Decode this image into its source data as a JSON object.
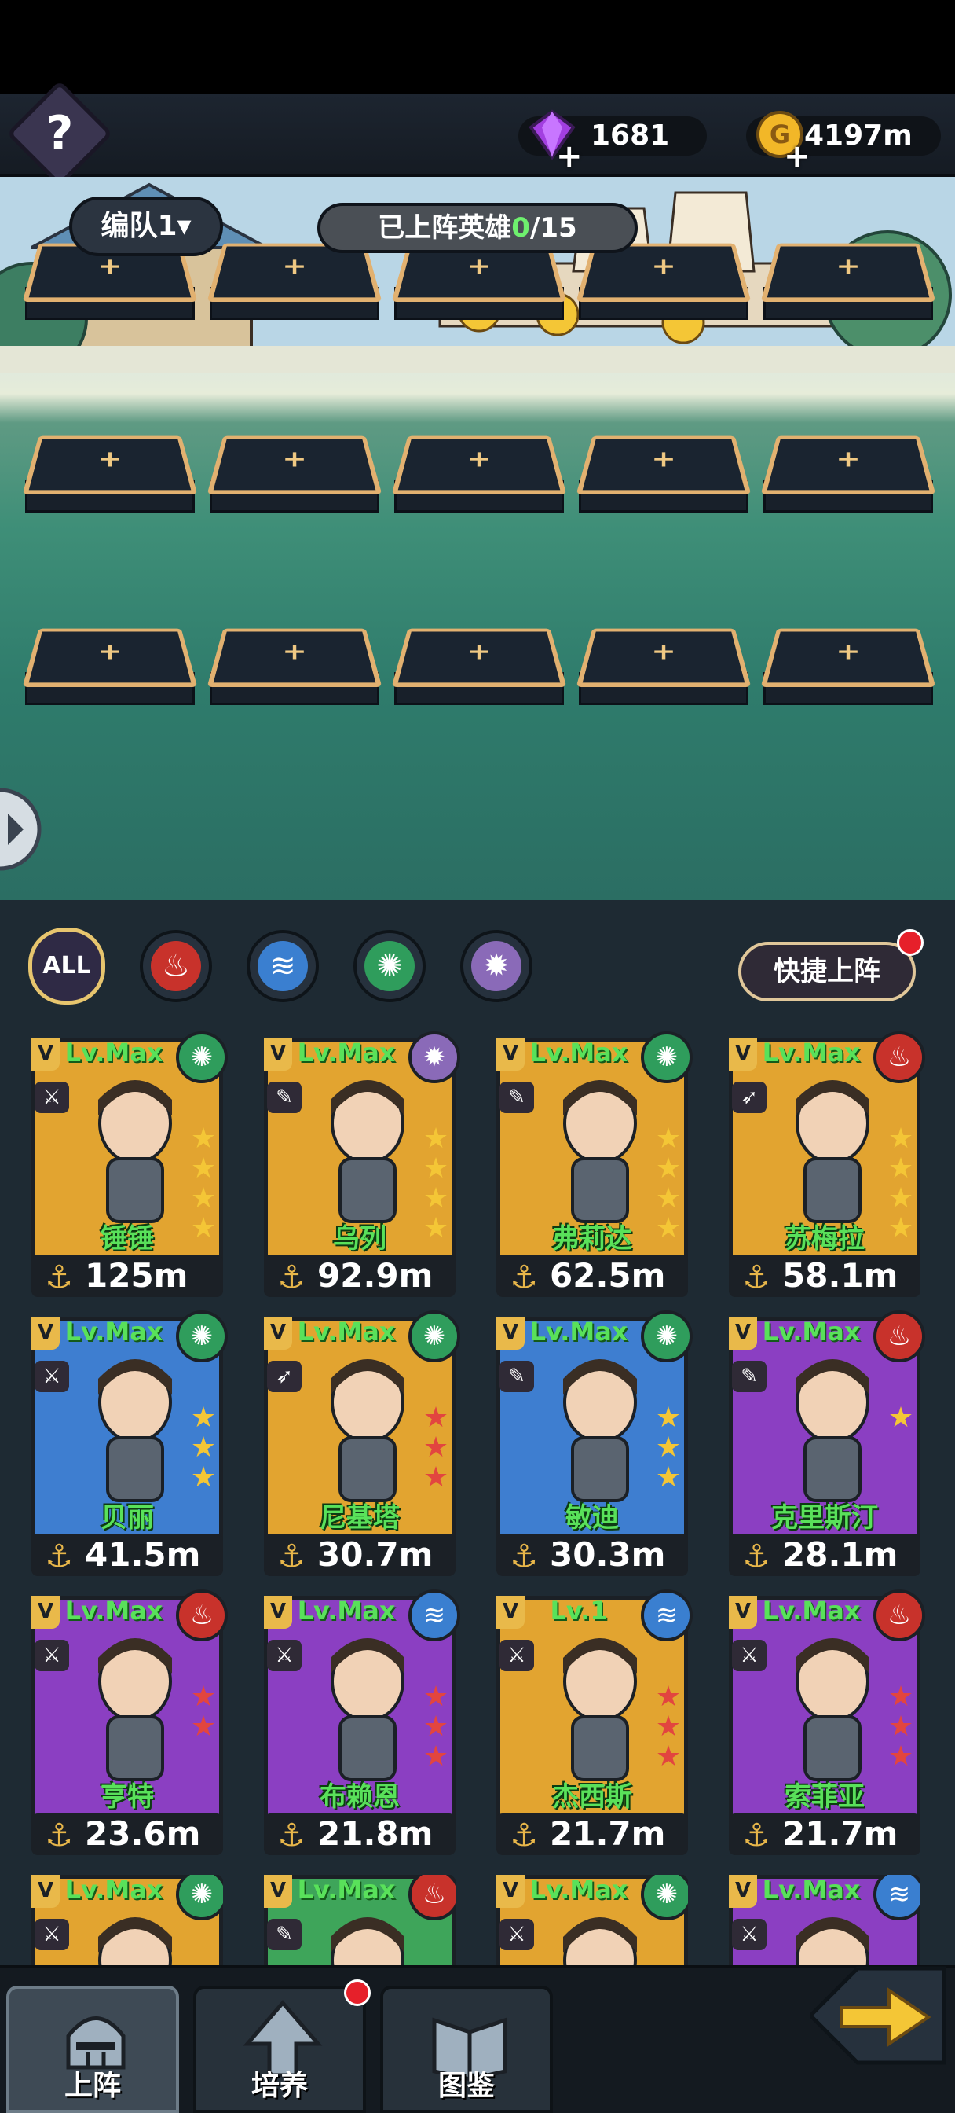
{
  "header": {
    "help_symbol": "?",
    "gems": "1681",
    "gold": "4197m"
  },
  "battlefield": {
    "team_selector": "编队1▾",
    "deploy_label": "已上阵英雄",
    "deploy_current": "0",
    "deploy_total": "/15",
    "slot_count": 15
  },
  "filters": {
    "all": "ALL",
    "icons": [
      "fire-icon",
      "water-icon",
      "wind-icon",
      "light-icon"
    ]
  },
  "quick_deploy": "快捷上阵",
  "heroes": [
    {
      "level": "Lv.Max",
      "name": "锤锤",
      "power": "125m",
      "element": "wind",
      "weapon": "sword",
      "stars": 4,
      "star_color": "gold",
      "bg": "#e2a430"
    },
    {
      "level": "Lv.Max",
      "name": "乌列",
      "power": "92.9m",
      "element": "light",
      "weapon": "staff",
      "stars": 4,
      "star_color": "gold",
      "bg": "#e2a430"
    },
    {
      "level": "Lv.Max",
      "name": "弗莉达",
      "power": "62.5m",
      "element": "wind",
      "weapon": "staff",
      "stars": 4,
      "star_color": "gold",
      "bg": "#e2a430"
    },
    {
      "level": "Lv.Max",
      "name": "苏梅拉",
      "power": "58.1m",
      "element": "fire",
      "weapon": "bow",
      "stars": 4,
      "star_color": "gold",
      "bg": "#e2a430"
    },
    {
      "level": "Lv.Max",
      "name": "贝丽",
      "power": "41.5m",
      "element": "wind",
      "weapon": "sword",
      "stars": 3,
      "star_color": "gold",
      "bg": "#3e7ed0"
    },
    {
      "level": "Lv.Max",
      "name": "尼基塔",
      "power": "30.7m",
      "element": "wind",
      "weapon": "bow",
      "stars": 3,
      "star_color": "red",
      "bg": "#e2a430"
    },
    {
      "level": "Lv.Max",
      "name": "敏迪",
      "power": "30.3m",
      "element": "wind",
      "weapon": "staff",
      "stars": 3,
      "star_color": "gold",
      "bg": "#3e7ed0"
    },
    {
      "level": "Lv.Max",
      "name": "克里斯汀",
      "power": "28.1m",
      "element": "fire",
      "weapon": "staff",
      "stars": 1,
      "star_color": "gold",
      "bg": "#8b3fc2"
    },
    {
      "level": "Lv.Max",
      "name": "亨特",
      "power": "23.6m",
      "element": "fire",
      "weapon": "sword",
      "stars": 2,
      "star_color": "red",
      "bg": "#8b3fc2"
    },
    {
      "level": "Lv.Max",
      "name": "布赖恩",
      "power": "21.8m",
      "element": "water",
      "weapon": "sword",
      "stars": 3,
      "star_color": "red",
      "bg": "#8b3fc2"
    },
    {
      "level": "Lv.1",
      "name": "杰西斯",
      "power": "21.7m",
      "element": "water",
      "weapon": "sword",
      "stars": 3,
      "star_color": "red",
      "bg": "#e2a430"
    },
    {
      "level": "Lv.Max",
      "name": "索菲亚",
      "power": "21.7m",
      "element": "fire",
      "weapon": "sword",
      "stars": 3,
      "star_color": "red",
      "bg": "#8b3fc2"
    },
    {
      "level": "Lv.Max",
      "name": "",
      "power": "",
      "element": "wind",
      "weapon": "sword",
      "stars": 0,
      "star_color": "gold",
      "bg": "#e2a430"
    },
    {
      "level": "Lv.Max",
      "name": "",
      "power": "",
      "element": "fire",
      "weapon": "staff",
      "stars": 0,
      "star_color": "gold",
      "bg": "#3ea55a"
    },
    {
      "level": "Lv.Max",
      "name": "",
      "power": "",
      "element": "wind",
      "weapon": "sword",
      "stars": 0,
      "star_color": "gold",
      "bg": "#e2a430"
    },
    {
      "level": "Lv.Max",
      "name": "",
      "power": "",
      "element": "water",
      "weapon": "sword",
      "stars": 0,
      "star_color": "gold",
      "bg": "#8b3fc2"
    }
  ],
  "nav": {
    "tabs": [
      {
        "label": "上阵",
        "icon": "knight-helmet-icon"
      },
      {
        "label": "培养",
        "icon": "upgrade-arrow-icon"
      },
      {
        "label": "图鉴",
        "icon": "book-icon"
      }
    ]
  },
  "colors": {
    "fire": "#c8322b",
    "water": "#3a7fd0",
    "wind": "#2f9d5c",
    "light": "#8a6ab8",
    "gold_star": "#f4c636",
    "red_star": "#e2453f"
  }
}
